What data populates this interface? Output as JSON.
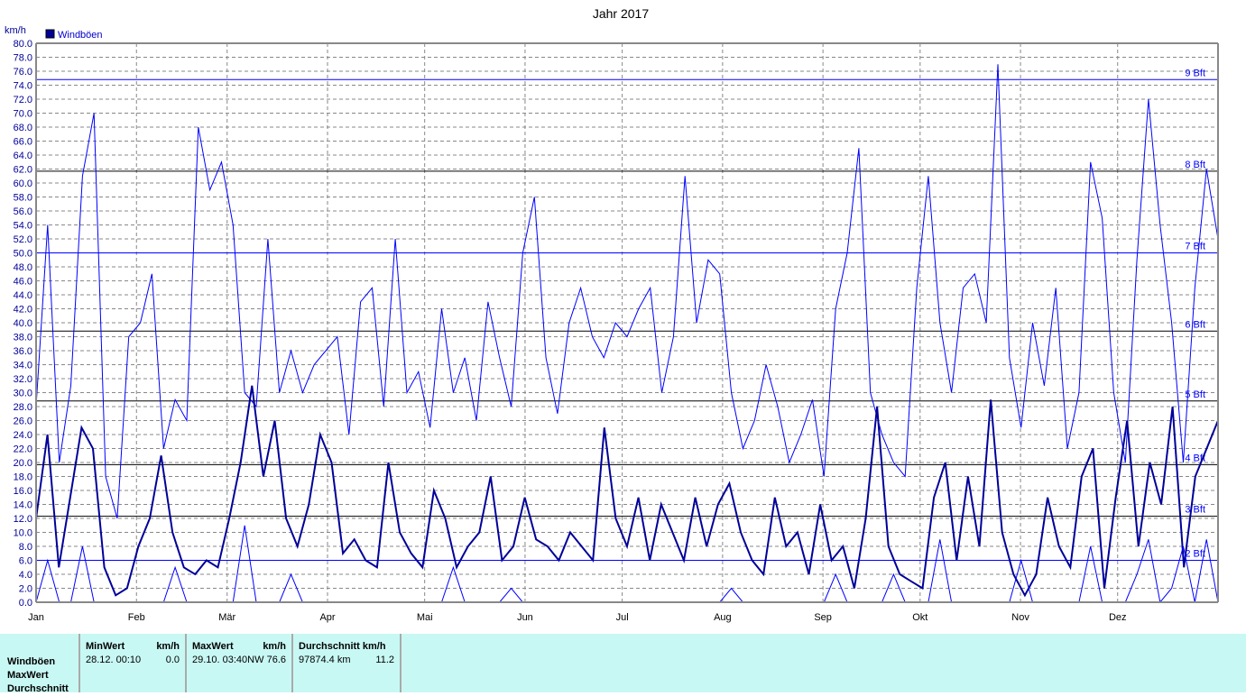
{
  "chart_data": {
    "type": "line",
    "title": "Jahr 2017",
    "ylabel": "km/h",
    "ylim": [
      0,
      80
    ],
    "yticks": [
      "0.0",
      "2.0",
      "4.0",
      "6.0",
      "8.0",
      "10.0",
      "12.0",
      "14.0",
      "16.0",
      "18.0",
      "20.0",
      "22.0",
      "24.0",
      "26.0",
      "28.0",
      "30.0",
      "32.0",
      "34.0",
      "36.0",
      "38.0",
      "40.0",
      "42.0",
      "44.0",
      "46.0",
      "48.0",
      "50.0",
      "52.0",
      "54.0",
      "56.0",
      "58.0",
      "60.0",
      "62.0",
      "64.0",
      "66.0",
      "68.0",
      "70.0",
      "72.0",
      "74.0",
      "76.0",
      "78.0",
      "80.0"
    ],
    "months": [
      "Jan",
      "Feb",
      "Mär",
      "Apr",
      "Mai",
      "Jun",
      "Jul",
      "Aug",
      "Sep",
      "Okt",
      "Nov",
      "Dez"
    ],
    "month_start_days": [
      0,
      31,
      59,
      90,
      120,
      151,
      181,
      212,
      243,
      273,
      304,
      334
    ],
    "days": 365,
    "legend": [
      {
        "label": "Windböen",
        "color": "#000099"
      }
    ],
    "grid": true,
    "bft_lines": [
      {
        "label": "2 Bft",
        "value": 6,
        "color": "#0000ff"
      },
      {
        "label": "3 Bft",
        "value": 12.3,
        "color": "#000000"
      },
      {
        "label": "4 Bft",
        "value": 19.7,
        "color": "#000000"
      },
      {
        "label": "5 Bft",
        "value": 28.8,
        "color": "#000000"
      },
      {
        "label": "6 Bft",
        "value": 38.8,
        "color": "#000000"
      },
      {
        "label": "7 Bft",
        "value": 50,
        "color": "#0000ff"
      },
      {
        "label": "8 Bft",
        "value": 61.7,
        "color": "#000000"
      },
      {
        "label": "9 Bft",
        "value": 74.8,
        "color": "#0000ff"
      }
    ],
    "series": [
      {
        "name": "Windböen MaxWert",
        "color": "#0000ff",
        "width": 1,
        "values": [
          28,
          54,
          20,
          31,
          61,
          70,
          18,
          12,
          38,
          40,
          47,
          22,
          29,
          26,
          68,
          59,
          63,
          54,
          30,
          28,
          52,
          30,
          36,
          30,
          34,
          36,
          38,
          24,
          43,
          45,
          28,
          52,
          30,
          33,
          25,
          42,
          30,
          35,
          26,
          43,
          35,
          28,
          50,
          58,
          35,
          27,
          40,
          45,
          38,
          35,
          40,
          38,
          42,
          45,
          30,
          38,
          61,
          40,
          49,
          47,
          30,
          22,
          26,
          34,
          28,
          20,
          24,
          29,
          18,
          42,
          50,
          65,
          30,
          24,
          20,
          18,
          45,
          61,
          40,
          30,
          45,
          47,
          40,
          77,
          35,
          25,
          40,
          31,
          45,
          22,
          30,
          63,
          55,
          30,
          20,
          49,
          72,
          54,
          40,
          20,
          45,
          62,
          52
        ]
      },
      {
        "name": "Windböen Durchschnitt",
        "color": "#000099",
        "width": 2,
        "values": [
          12,
          24,
          5,
          15,
          25,
          22,
          5,
          1,
          2,
          8,
          12,
          21,
          10,
          5,
          4,
          6,
          5,
          12,
          20,
          31,
          18,
          26,
          12,
          8,
          14,
          24,
          20,
          7,
          9,
          6,
          5,
          20,
          10,
          7,
          5,
          16,
          12,
          5,
          8,
          10,
          18,
          6,
          8,
          15,
          9,
          8,
          6,
          10,
          8,
          6,
          25,
          12,
          8,
          15,
          6,
          14,
          10,
          6,
          15,
          8,
          14,
          17,
          10,
          6,
          4,
          15,
          8,
          10,
          4,
          14,
          6,
          8,
          2,
          12,
          28,
          8,
          4,
          3,
          2,
          15,
          20,
          6,
          18,
          8,
          29,
          10,
          4,
          1,
          4,
          15,
          8,
          5,
          18,
          22,
          2,
          15,
          26,
          8,
          20,
          14,
          28,
          5,
          18,
          22,
          26
        ]
      },
      {
        "name": "Windböen MinWert",
        "color": "#0000ff",
        "width": 1,
        "values": [
          0,
          6,
          0,
          0,
          8,
          0,
          0,
          0,
          0,
          0,
          0,
          0,
          5,
          0,
          0,
          0,
          0,
          0,
          11,
          0,
          0,
          0,
          4,
          0,
          0,
          0,
          0,
          0,
          0,
          0,
          0,
          0,
          0,
          0,
          0,
          0,
          5,
          0,
          0,
          0,
          0,
          2,
          0,
          0,
          0,
          0,
          0,
          0,
          0,
          0,
          0,
          0,
          0,
          0,
          0,
          0,
          0,
          0,
          0,
          0,
          2,
          0,
          0,
          0,
          0,
          0,
          0,
          0,
          0,
          4,
          0,
          0,
          0,
          0,
          4,
          0,
          0,
          0,
          9,
          0,
          0,
          0,
          0,
          0,
          0,
          6,
          0,
          0,
          0,
          0,
          0,
          8,
          0,
          0,
          0,
          4,
          9,
          0,
          2,
          8,
          0,
          9,
          0
        ]
      }
    ]
  },
  "table": {
    "row_labels": [
      "Windböen",
      "MaxWert",
      "Durchschnitt"
    ],
    "min": {
      "header": "MinWert",
      "unit": "km/h",
      "date": "28.12.  00:10",
      "value": "0.0"
    },
    "max": {
      "header": "MaxWert",
      "unit": "km/h",
      "date": "29.10.  03:40NW",
      "value": "76.6"
    },
    "avg": {
      "header": "Durchschnitt km/h",
      "dist": "97874.4 km",
      "value": "11.2"
    }
  }
}
